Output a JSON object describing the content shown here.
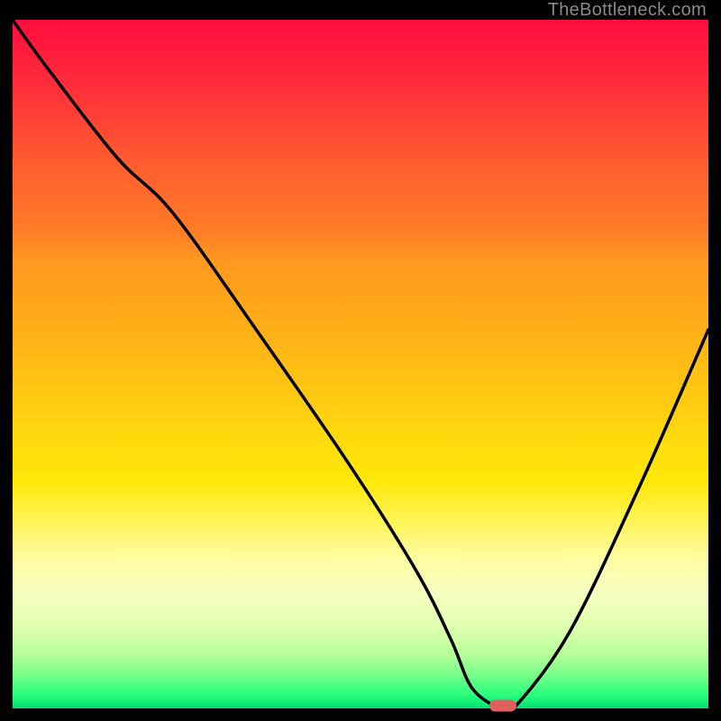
{
  "watermark": "TheBottleneck.com",
  "chart_data": {
    "type": "line",
    "title": "",
    "xlabel": "",
    "ylabel": "",
    "xlim": [
      0,
      100
    ],
    "ylim": [
      0,
      100
    ],
    "series": [
      {
        "name": "curve",
        "x": [
          0,
          5,
          15,
          23,
          35,
          48,
          58,
          63,
          66,
          70,
          72,
          80,
          90,
          100
        ],
        "y": [
          100,
          93,
          80,
          72,
          55,
          36,
          20,
          10,
          3,
          0,
          0,
          11,
          32,
          55
        ]
      }
    ],
    "marker": {
      "x": 70.5,
      "y": 0,
      "color": "#e06060"
    },
    "gradient_stops": [
      {
        "pos": 0.0,
        "color": "#ff0d3e"
      },
      {
        "pos": 0.35,
        "color": "#ff9820"
      },
      {
        "pos": 0.65,
        "color": "#ffe80a"
      },
      {
        "pos": 0.85,
        "color": "#d5ffa0"
      },
      {
        "pos": 1.0,
        "color": "#00e070"
      }
    ]
  }
}
